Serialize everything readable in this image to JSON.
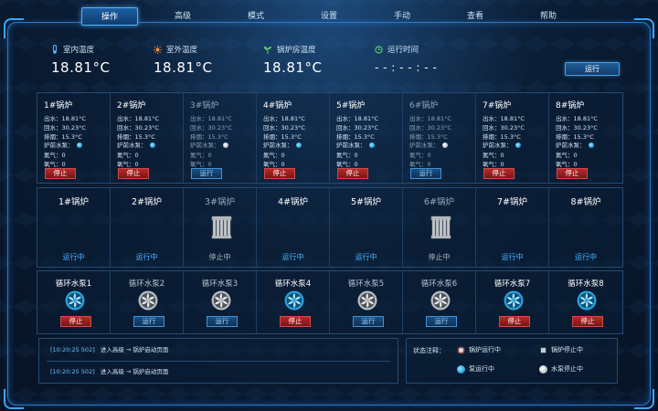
{
  "nav": {
    "items": [
      "操作",
      "高级",
      "模式",
      "设置",
      "手动",
      "查看",
      "帮助"
    ],
    "active": "操作"
  },
  "stats": {
    "indoor_label": "室内温度",
    "indoor_value": "18.81°C",
    "outdoor_label": "室外温度",
    "outdoor_value": "18.81°C",
    "boiler_room_label": "锅炉房温度",
    "boiler_room_value": "18.81°C",
    "runtime_label": "运行时间",
    "runtime_value": "- - : - - : - -",
    "run_button": "运行"
  },
  "boilers": [
    {
      "name": "1#锅炉",
      "supply": "出水：18.81°C",
      "return": "回水：30.23°C",
      "exhaust": "排烟：15.3°C",
      "pump_label": "炉前水泵：",
      "nitrogen": "氮气：0",
      "oxygen": "氧气：0",
      "button": "停止",
      "running": true,
      "status": "运行中"
    },
    {
      "name": "2#锅炉",
      "supply": "出水：18.81°C",
      "return": "回水：30.23°C",
      "exhaust": "排烟：15.3°C",
      "pump_label": "炉前水泵：",
      "nitrogen": "氮气：0",
      "oxygen": "氧气：0",
      "button": "停止",
      "running": true,
      "status": "运行中"
    },
    {
      "name": "3#锅炉",
      "supply": "出水：18.81°C",
      "return": "回水：30.23°C",
      "exhaust": "排烟：15.3°C",
      "pump_label": "炉前水泵：",
      "nitrogen": "氮气：0",
      "oxygen": "氧气：0",
      "button": "运行",
      "running": false,
      "status": "停止中"
    },
    {
      "name": "4#锅炉",
      "supply": "出水：18.81°C",
      "return": "回水：30.23°C",
      "exhaust": "排烟：15.3°C",
      "pump_label": "炉前水泵：",
      "nitrogen": "氮气：0",
      "oxygen": "氧气：0",
      "button": "停止",
      "running": true,
      "status": "运行中"
    },
    {
      "name": "5#锅炉",
      "supply": "出水：18.81°C",
      "return": "回水：30.23°C",
      "exhaust": "排烟：15.3°C",
      "pump_label": "炉前水泵：",
      "nitrogen": "氮气：0",
      "oxygen": "氧气：0",
      "button": "停止",
      "running": true,
      "status": "运行中"
    },
    {
      "name": "6#锅炉",
      "supply": "出水：18.81°C",
      "return": "回水：30.23°C",
      "exhaust": "排烟：15.3°C",
      "pump_label": "炉前水泵：",
      "nitrogen": "氮气：0",
      "oxygen": "氧气：0",
      "button": "运行",
      "running": false,
      "status": "停止中"
    },
    {
      "name": "7#锅炉",
      "supply": "出水：18.81°C",
      "return": "回水：30.23°C",
      "exhaust": "排烟：15.3°C",
      "pump_label": "炉前水泵：",
      "nitrogen": "氮气：0",
      "oxygen": "氧气：0",
      "button": "停止",
      "running": true,
      "status": "运行中"
    },
    {
      "name": "8#锅炉",
      "supply": "出水：18.81°C",
      "return": "回水：30.23°C",
      "exhaust": "排烟：15.3°C",
      "pump_label": "炉前水泵：",
      "nitrogen": "氮气：0",
      "oxygen": "氧气：0",
      "button": "停止",
      "running": true,
      "status": "运行中"
    }
  ],
  "pumps": [
    {
      "name": "循环水泵1",
      "running": true,
      "button": "停止"
    },
    {
      "name": "循环水泵2",
      "running": false,
      "button": "运行"
    },
    {
      "name": "循环水泵3",
      "running": false,
      "button": "运行"
    },
    {
      "name": "循环水泵4",
      "running": true,
      "button": "停止"
    },
    {
      "name": "循环水泵5",
      "running": false,
      "button": "运行"
    },
    {
      "name": "循环水泵6",
      "running": false,
      "button": "运行"
    },
    {
      "name": "循环水泵7",
      "running": true,
      "button": "停止"
    },
    {
      "name": "循环水泵8",
      "running": true,
      "button": "停止"
    }
  ],
  "log": [
    {
      "time": "[10:20:25  502]",
      "text": "进入高级 → 锅炉启动页面"
    },
    {
      "time": "[10:20:25  502]",
      "text": "进入高级 → 锅炉启动页面"
    }
  ],
  "legend": {
    "title": "状态注释：",
    "boiler_running": "锅炉运行中",
    "boiler_stopped": "锅炉停止中",
    "pump_running": "泵运行中",
    "pump_stopped": "水泵停止中"
  },
  "colors": {
    "accent": "#39a7ff",
    "stop": "#a52020",
    "run_text": "#48b4ff",
    "background": "#0b1e36"
  }
}
